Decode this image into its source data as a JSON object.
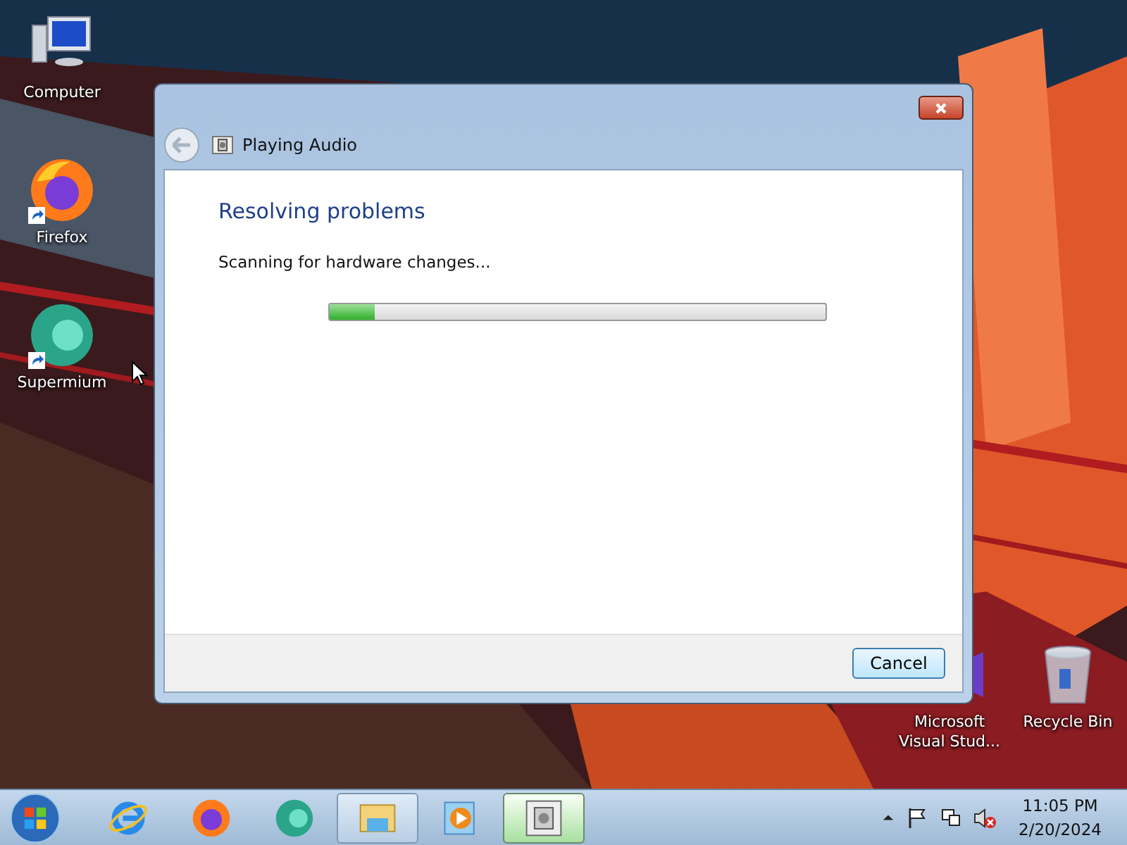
{
  "desktop": {
    "left_icons": [
      {
        "label": "Computer",
        "kind": "computer",
        "shortcut": false
      },
      {
        "label": "Firefox",
        "kind": "firefox",
        "shortcut": true
      },
      {
        "label": "Supermium",
        "kind": "supermium",
        "shortcut": true
      }
    ],
    "right_icons": [
      {
        "label": "Microsoft Visual Stud...",
        "kind": "vstudio",
        "shortcut": false
      },
      {
        "label": "Recycle Bin",
        "kind": "recycle",
        "shortcut": false
      }
    ]
  },
  "window": {
    "title": "Playing Audio",
    "heading": "Resolving problems",
    "status": "Scanning for hardware changes...",
    "progress": {
      "level": 0.09
    },
    "buttons": [
      "Cancel"
    ]
  },
  "taskbar": {
    "items": [
      {
        "kind": "ie",
        "running": false,
        "selected": false
      },
      {
        "kind": "firefox",
        "running": false,
        "selected": false
      },
      {
        "kind": "supermium",
        "running": false,
        "selected": false
      },
      {
        "kind": "explorer",
        "running": true,
        "selected": false
      },
      {
        "kind": "media",
        "running": false,
        "selected": false
      },
      {
        "kind": "troubleshooter",
        "running": true,
        "selected": true
      }
    ],
    "clock": {
      "time": "11:05 PM",
      "date": "2/20/2024"
    }
  }
}
